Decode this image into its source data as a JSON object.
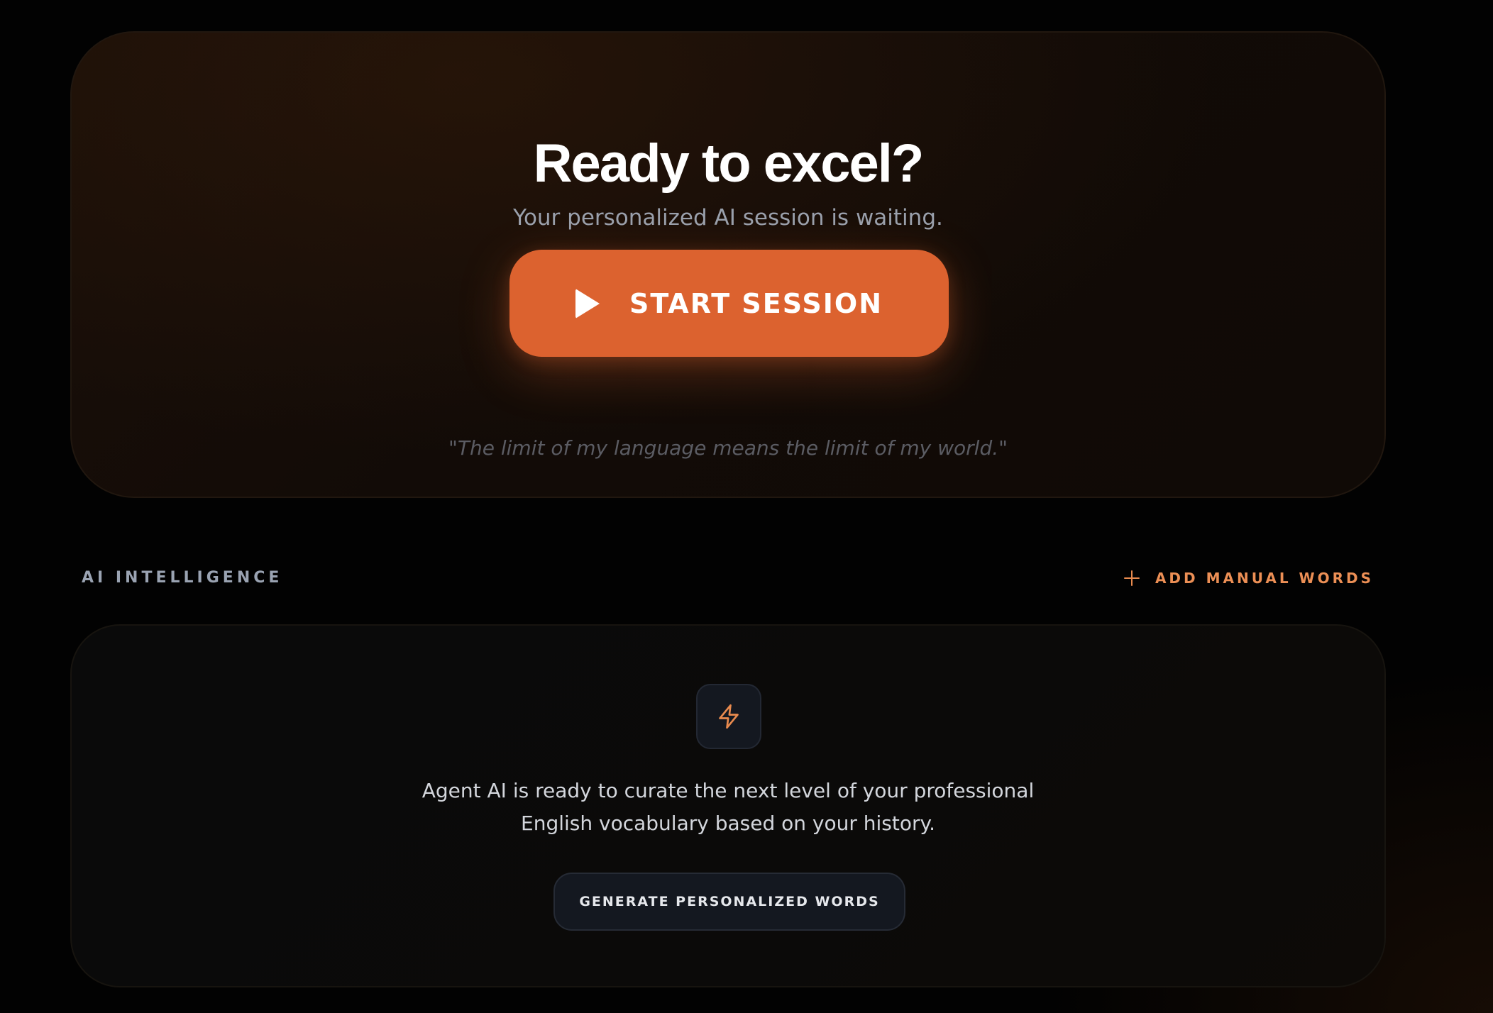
{
  "hero": {
    "title": "Ready to excel?",
    "subtitle": "Your personalized AI session is waiting.",
    "start_button": {
      "label": "START SESSION",
      "icon": "play-icon"
    },
    "quote": "\"The limit of my language means the limit of my world.\""
  },
  "section": {
    "label": "AI INTELLIGENCE",
    "add_words": {
      "label": "ADD MANUAL WORDS",
      "icon": "plus-icon"
    }
  },
  "ai_card": {
    "icon": "lightning-bolt-icon",
    "description_line1": "Agent AI is ready to curate the next level of your professional",
    "description_line2": "English vocabulary based on your history.",
    "generate_button": {
      "label": "GENERATE PERSONALIZED WORDS"
    }
  },
  "colors": {
    "accent": "#dc622f",
    "accent_text": "#ec8f55",
    "background": "#020202"
  }
}
